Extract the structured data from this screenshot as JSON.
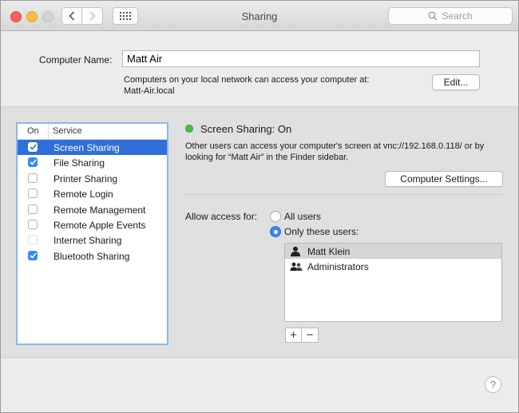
{
  "window": {
    "title": "Sharing"
  },
  "search": {
    "placeholder": "Search"
  },
  "computer_name": {
    "label": "Computer Name:",
    "value": "Matt Air",
    "info_line1": "Computers on your local network can access your computer at:",
    "info_line2": "Matt-Air.local",
    "edit_label": "Edit..."
  },
  "services": {
    "header_on": "On",
    "header_service": "Service",
    "items": [
      {
        "name": "Screen Sharing",
        "checked": true,
        "selected": true
      },
      {
        "name": "File Sharing",
        "checked": true,
        "selected": false
      },
      {
        "name": "Printer Sharing",
        "checked": false,
        "selected": false
      },
      {
        "name": "Remote Login",
        "checked": false,
        "selected": false
      },
      {
        "name": "Remote Management",
        "checked": false,
        "selected": false
      },
      {
        "name": "Remote Apple Events",
        "checked": false,
        "selected": false
      },
      {
        "name": "Internet Sharing",
        "checked": false,
        "selected": false
      },
      {
        "name": "Bluetooth Sharing",
        "checked": true,
        "selected": false
      }
    ]
  },
  "detail": {
    "status": "Screen Sharing: On",
    "status_color": "#3ec14a",
    "info_line1": "Other users can access your computer's screen at vnc://192.168.0.118/ or by",
    "info_line2": "looking for “Matt Air” in the Finder sidebar.",
    "settings_label": "Computer Settings...",
    "access_label": "Allow access for:",
    "option_all": "All users",
    "option_only": "Only these users:",
    "selected_option": "only",
    "users": [
      {
        "name": "Matt Klein",
        "icon": "user-icon"
      },
      {
        "name": "Administrators",
        "icon": "group-icon"
      }
    ],
    "add_label": "+",
    "remove_label": "−"
  },
  "accent_color": "#3b86f5",
  "selection_color": "#2f6fd7"
}
